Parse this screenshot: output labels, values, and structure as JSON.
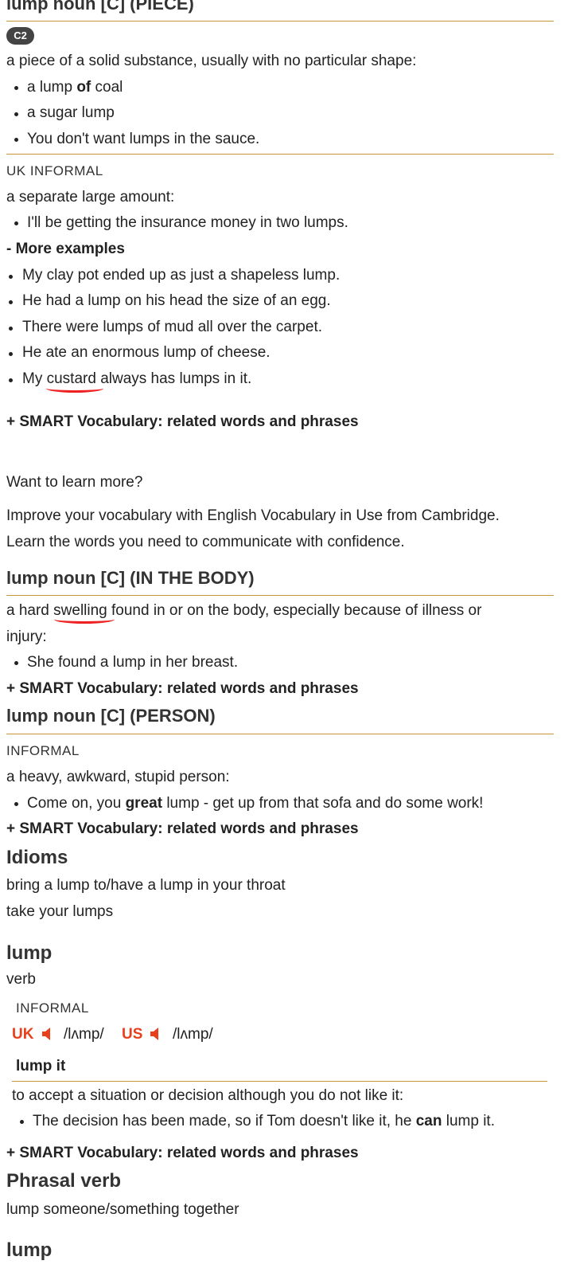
{
  "sense_piece": {
    "heading": "lump noun [C] (PIECE)",
    "level_badge": "C2",
    "definition": "a piece of a solid substance, usually with no particular shape:",
    "example1_pre": "a lump ",
    "example1_bold": "of",
    "example1_post": " coal",
    "example2": "a sugar lump",
    "example3": "You don't want lumps in the sauce."
  },
  "sense_amount": {
    "register": "UK INFORMAL",
    "definition": "a separate large amount:",
    "example1": "I'll be getting the insurance money in two lumps."
  },
  "more_examples": {
    "toggle": "- More examples",
    "items": [
      "My clay pot ended up as just a shapeless lump.",
      "He had a lump on his head the size of an egg.",
      "There were lumps of mud all over the carpet.",
      "He ate an enormous lump of cheese.",
      "My custard always has lumps in it."
    ]
  },
  "smart_vocab_label": "+ SMART Vocabulary: related words and phrases",
  "promo": {
    "title": "Want to learn more?",
    "line1": "Improve your vocabulary with English Vocabulary in Use from Cambridge.",
    "line2": "Learn the words you need to communicate with confidence."
  },
  "sense_body": {
    "heading": "lump noun [C] (IN THE BODY)",
    "definition_line1": "a hard swelling found in or on the body, especially because of illness or",
    "definition_line2": "injury:",
    "example1": "She found a lump in her breast."
  },
  "sense_person": {
    "heading": "lump noun [C] (PERSON)",
    "register": "INFORMAL",
    "definition": "a heavy, awkward, stupid person:",
    "example_pre": "Come on, you ",
    "example_bold": "great",
    "example_post": " lump - get up from that sofa and do some work!"
  },
  "idioms": {
    "heading": "Idioms",
    "items": [
      "bring a lump to/have a lump in your throat",
      "take your lumps"
    ]
  },
  "verb_entry": {
    "headword": "lump",
    "pos": "verb",
    "register": "INFORMAL",
    "uk_label": "UK",
    "uk_ipa": "/lʌmp/",
    "us_label": "US",
    "us_ipa": "/lʌmp/",
    "phrase": "lump it",
    "definition": "to accept a situation or decision although you do not like it:",
    "example_pre": "The decision has been made, so if Tom doesn't like it, he ",
    "example_bold": "can",
    "example_post": " lump it."
  },
  "phrasal": {
    "heading": "Phrasal verb",
    "item": "lump someone/something together"
  },
  "next_entry": {
    "headword": "lump"
  },
  "colors": {
    "rule": "#c8953e",
    "accent": "#e8401c",
    "squiggle": "#e22222"
  }
}
